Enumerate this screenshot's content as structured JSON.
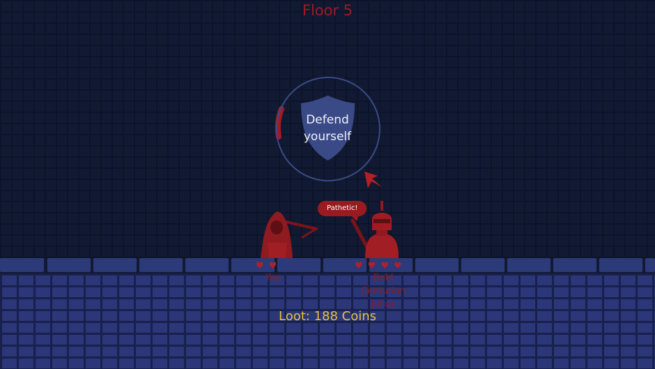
{
  "floor": {
    "title": "Floor 5"
  },
  "action": {
    "label": "Defend\nyourself",
    "icon": "shield-icon",
    "timer_icon": "timer-arc"
  },
  "enemy": {
    "speech": "Pathetic!",
    "name": "Bold\nCenturion\nJulius",
    "hearts": 4
  },
  "player": {
    "name": "You",
    "hearts": 2
  },
  "loot": {
    "text": "Loot: 188 Coins"
  },
  "colors": {
    "wall": "#121a33",
    "floor": "#2b3778",
    "accent_red": "#9b1a20",
    "loot_yellow": "#e9c342",
    "text_white": "#f0f2fa"
  }
}
